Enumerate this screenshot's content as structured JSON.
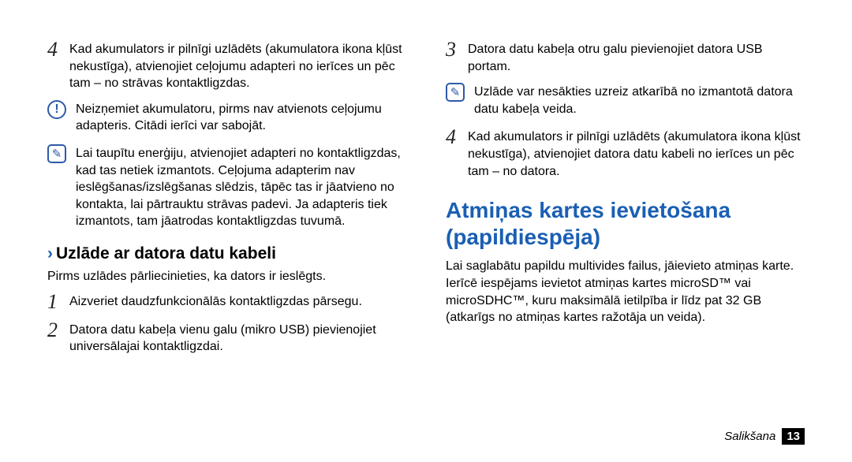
{
  "left": {
    "step4": "Kad akumulators ir pilnīgi uzlādēts (akumulatora ikona kļūst nekustīga), atvienojiet ceļojumu adapteri no ierīces un pēc tam – no strāvas kontaktligzdas.",
    "warning": "Neizņemiet akumulatoru, pirms nav atvienots ceļojumu adapteris. Citādi ierīci var sabojāt.",
    "note": "Lai taupītu enerģiju, atvienojiet adapteri no kontaktligzdas, kad tas netiek izmantots. Ceļojuma adapterim nav ieslēgšanas/izslēgšanas slēdzis, tāpēc tas ir jāatvieno no kontakta, lai pārtrauktu strāvas padevi. Ja adapteris tiek izmantots, tam jāatrodas kontaktligzdas tuvumā.",
    "subheading": "Uzlāde ar datora datu kabeli",
    "pretext": "Pirms uzlādes pārliecinieties, ka dators ir ieslēgts.",
    "step1": "Aizveriet daudzfunkcionālās kontaktligzdas pārsegu.",
    "step2": "Datora datu kabeļa vienu galu (mikro USB) pievienojiet universālajai kontaktligzdai."
  },
  "right": {
    "step3": "Datora datu kabeļa otru galu pievienojiet datora USB portam.",
    "note": "Uzlāde var nesākties uzreiz atkarībā no izmantotā datora datu kabeļa veida.",
    "step4": "Kad akumulators ir pilnīgi uzlādēts (akumulatora ikona kļūst nekustīga), atvienojiet datora datu kabeli no ierīces un pēc tam – no datora.",
    "heading": "Atmiņas kartes ievietošana (papildiespēja)",
    "para": "Lai saglabātu papildu multivides failus, jāievieto atmiņas karte. Ierīcē iespējams ievietot atmiņas kartes microSD™ vai microSDHC™, kuru maksimālā ietilpība ir līdz pat 32 GB (atkarīgs no atmiņas kartes ražotāja un veida)."
  },
  "footer": {
    "section": "Salikšana",
    "page": "13"
  },
  "nums": {
    "n1": "1",
    "n2": "2",
    "n3": "3",
    "n4": "4"
  },
  "glyphs": {
    "pencil": "✎"
  }
}
